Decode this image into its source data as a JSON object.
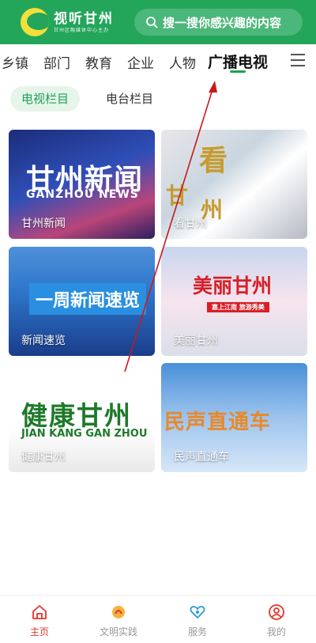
{
  "header": {
    "logo_title": "视听甘州",
    "logo_subtitle": "甘州区融媒体中心主办",
    "search_placeholder": "搜一搜你感兴趣的内容",
    "search_icon": "search-icon"
  },
  "categories": [
    "乡镇",
    "部门",
    "教育",
    "企业",
    "人物",
    "广播电视"
  ],
  "active_category": "广播电视",
  "subtabs": {
    "active": "电视栏目",
    "inactive": "电台栏目"
  },
  "cards": [
    {
      "caption": "甘州新闻",
      "art_main": "甘州新闻",
      "art_sub": "GANZHOU NEWS"
    },
    {
      "caption": "看甘州",
      "art_main": "看",
      "art_sub1": "甘",
      "art_sub2": "州"
    },
    {
      "caption": "新闻速览",
      "art_main": "一周新闻速览"
    },
    {
      "caption": "美丽甘州",
      "art_main": "美丽甘州",
      "art_sub": "塞上江南 旅游秀美"
    },
    {
      "caption": "健康甘州",
      "art_main": "健康甘州",
      "art_sub": "JIAN KANG GAN ZHOU"
    },
    {
      "caption": "民声直通车",
      "art_main": "民声直通车"
    }
  ],
  "bottom_tabs": [
    {
      "label": "主页",
      "icon": "home-icon",
      "active": true
    },
    {
      "label": "文明实践",
      "icon": "civilization-icon",
      "active": false
    },
    {
      "label": "服务",
      "icon": "service-icon",
      "active": false
    },
    {
      "label": "我的",
      "icon": "user-icon",
      "active": false
    }
  ],
  "colors": {
    "brand_green": "#23a65a",
    "active_tab_red": "#e6352b",
    "annotation_red": "#c8191f"
  }
}
